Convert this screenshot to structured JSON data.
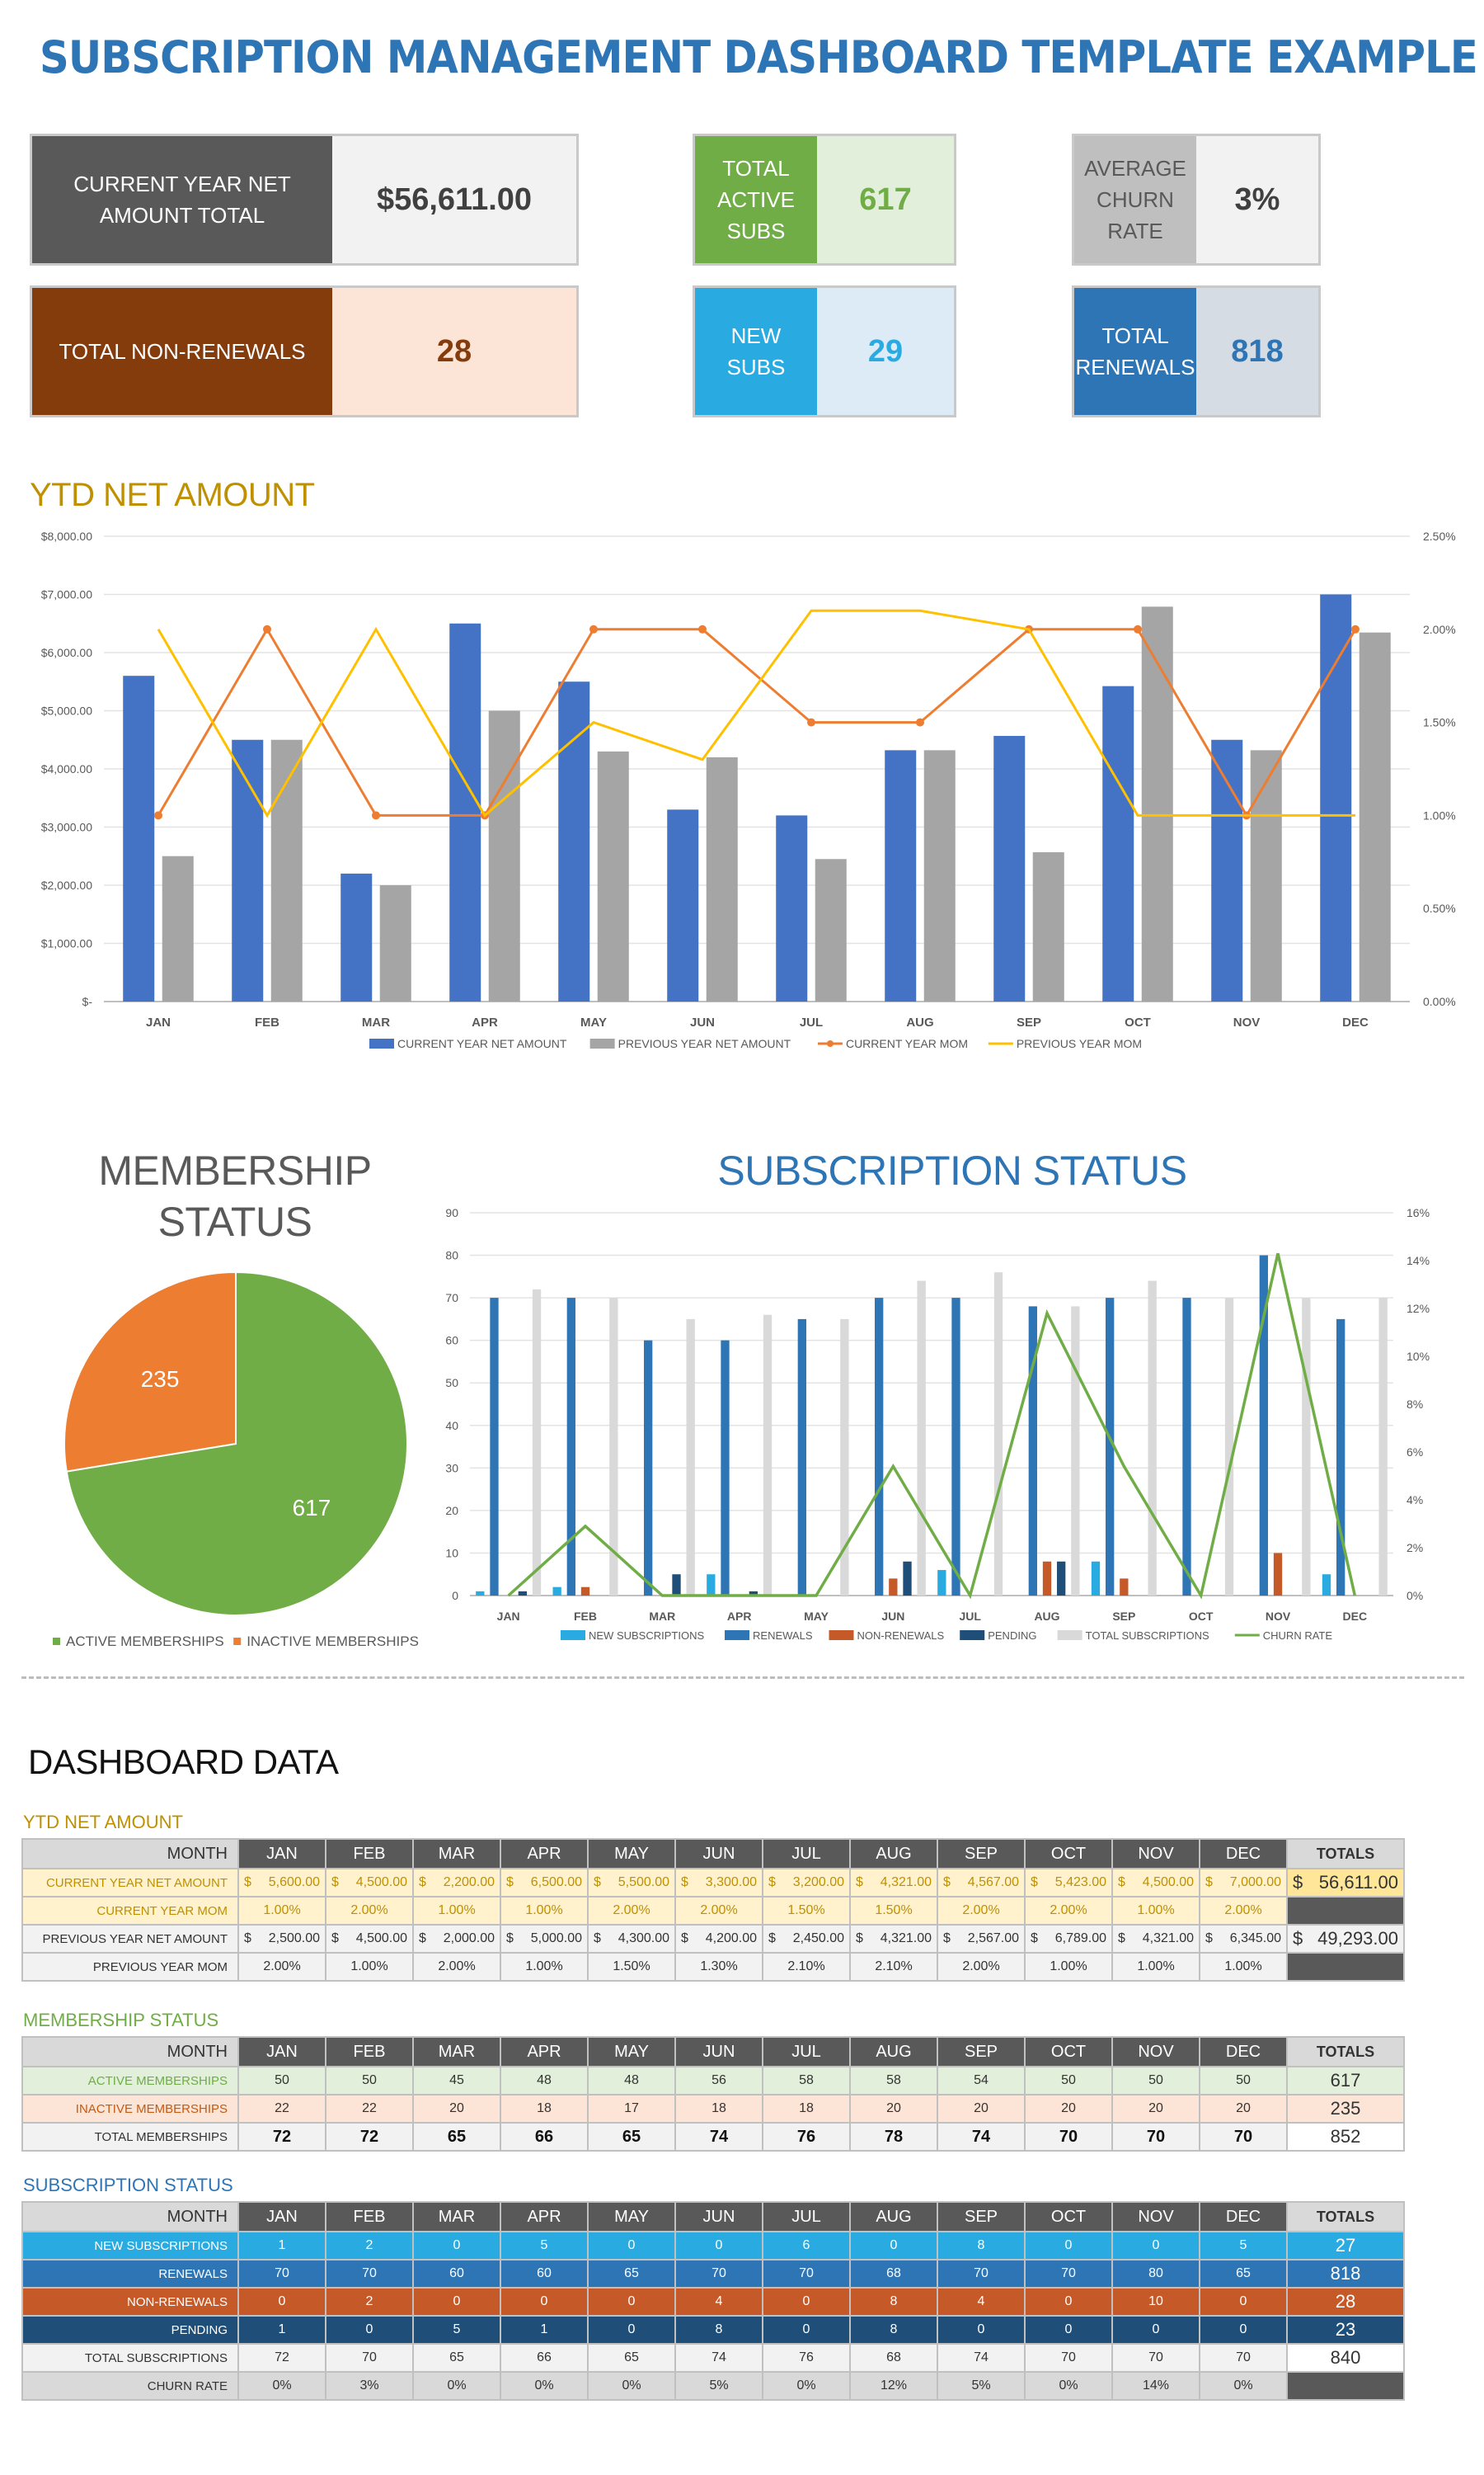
{
  "page": {
    "title": "SUBSCRIPTION MANAGEMENT DASHBOARD TEMPLATE EXAMPLE",
    "colors": {
      "title": "#2e75b6",
      "ytd_heading": "#bf9000",
      "membership_heading": "#595959",
      "subscription_heading": "#2e75b6",
      "table_ytd_caption": "#bf9000",
      "table_membership_caption": "#70ad47",
      "table_subscription_caption": "#2e75b6"
    }
  },
  "kpis": [
    {
      "label": "CURRENT YEAR NET AMOUNT TOTAL",
      "value": "$56,611.00",
      "label_bg": "#595959",
      "value_bg": "#f2f2f2",
      "value_color": "#404040"
    },
    {
      "label": "TOTAL NON-RENEWALS",
      "value": "28",
      "label_bg": "#843c0c",
      "value_bg": "#fce4d6",
      "value_color": "#843c0c"
    },
    {
      "label": "TOTAL ACTIVE SUBS",
      "value": "617",
      "label_bg": "#70ad47",
      "value_bg": "#e2efda",
      "value_color": "#70ad47"
    },
    {
      "label": "NEW SUBS",
      "value": "29",
      "label_bg": "#29abe2",
      "value_bg": "#ddebf7",
      "value_color": "#29abe2"
    },
    {
      "label": "AVERAGE CHURN RATE",
      "value": "3%",
      "label_bg": "#bfbfbf",
      "value_bg": "#f2f2f2",
      "value_color": "#404040",
      "label_color": "#595959"
    },
    {
      "label": "TOTAL RENEWALS",
      "value": "818",
      "label_bg": "#2e75b6",
      "value_bg": "#d6dce4",
      "value_color": "#2e75b6"
    }
  ],
  "chart_data": [
    {
      "id": "ytd",
      "type": "bar",
      "title": "YTD NET AMOUNT",
      "categories": [
        "JAN",
        "FEB",
        "MAR",
        "APR",
        "MAY",
        "JUN",
        "JUL",
        "AUG",
        "SEP",
        "OCT",
        "NOV",
        "DEC"
      ],
      "series": [
        {
          "name": "CURRENT YEAR NET AMOUNT",
          "kind": "bar",
          "axis": "left",
          "color": "#4472c4",
          "values": [
            5600,
            4500,
            2200,
            6500,
            5500,
            3300,
            3200,
            4321,
            4567,
            5423,
            4500,
            7000
          ]
        },
        {
          "name": "PREVIOUS YEAR NET AMOUNT",
          "kind": "bar",
          "axis": "left",
          "color": "#a5a5a5",
          "values": [
            2500,
            4500,
            2000,
            5000,
            4300,
            4200,
            2450,
            4321,
            2567,
            6789,
            4321,
            6345
          ]
        },
        {
          "name": "CURRENT YEAR MOM",
          "kind": "line",
          "axis": "right",
          "color": "#ed7d31",
          "markers": true,
          "values": [
            1.0,
            2.0,
            1.0,
            1.0,
            2.0,
            2.0,
            1.5,
            1.5,
            2.0,
            2.0,
            1.0,
            2.0
          ]
        },
        {
          "name": "PREVIOUS YEAR MOM",
          "kind": "line",
          "axis": "right",
          "color": "#ffc000",
          "markers": false,
          "values": [
            2.0,
            1.0,
            2.0,
            1.0,
            1.5,
            1.3,
            2.1,
            2.1,
            2.0,
            1.0,
            1.0,
            1.0
          ]
        }
      ],
      "ylim": [
        0,
        8000
      ],
      "y_ticks": [
        "$-",
        "$1,000.00",
        "$2,000.00",
        "$3,000.00",
        "$4,000.00",
        "$5,000.00",
        "$6,000.00",
        "$7,000.00",
        "$8,000.00"
      ],
      "y2lim": [
        0,
        2.5
      ],
      "y2_ticks": [
        "0.00%",
        "0.50%",
        "1.00%",
        "1.50%",
        "2.00%",
        "2.50%"
      ],
      "grid": true,
      "legend": "bottom"
    },
    {
      "id": "membership",
      "type": "pie",
      "title": "MEMBERSHIP STATUS",
      "slices": [
        {
          "label": "ACTIVE MEMBERSHIPS",
          "value": 617,
          "color": "#70ad47"
        },
        {
          "label": "INACTIVE MEMBERSHIPS",
          "value": 235,
          "color": "#ed7d31"
        }
      ],
      "legend": "bottom"
    },
    {
      "id": "subscription",
      "type": "bar",
      "title": "SUBSCRIPTION STATUS",
      "categories": [
        "JAN",
        "FEB",
        "MAR",
        "APR",
        "MAY",
        "JUN",
        "JUL",
        "AUG",
        "SEP",
        "OCT",
        "NOV",
        "DEC"
      ],
      "series": [
        {
          "name": "NEW SUBSCRIPTIONS",
          "kind": "bar",
          "axis": "left",
          "color": "#29abe2",
          "values": [
            1,
            2,
            0,
            5,
            0,
            0,
            6,
            0,
            8,
            0,
            0,
            5
          ]
        },
        {
          "name": "RENEWALS",
          "kind": "bar",
          "axis": "left",
          "color": "#2e75b6",
          "values": [
            70,
            70,
            60,
            60,
            65,
            70,
            70,
            68,
            70,
            70,
            80,
            65
          ]
        },
        {
          "name": "NON-RENEWALS",
          "kind": "bar",
          "axis": "left",
          "color": "#c55a28",
          "values": [
            0,
            2,
            0,
            0,
            0,
            4,
            0,
            8,
            4,
            0,
            10,
            0
          ]
        },
        {
          "name": "PENDING",
          "kind": "bar",
          "axis": "left",
          "color": "#1f4e79",
          "values": [
            1,
            0,
            5,
            1,
            0,
            8,
            0,
            8,
            0,
            0,
            0,
            0
          ]
        },
        {
          "name": "TOTAL SUBSCRIPTIONS",
          "kind": "bar",
          "axis": "left",
          "color": "#d9d9d9",
          "values": [
            72,
            70,
            65,
            66,
            65,
            74,
            76,
            68,
            74,
            70,
            70,
            70
          ]
        },
        {
          "name": "CHURN RATE",
          "kind": "line",
          "axis": "right",
          "color": "#70ad47",
          "values": [
            0,
            2.9,
            0,
            0,
            0,
            5.4,
            0,
            11.8,
            5.4,
            0,
            14.3,
            0
          ]
        }
      ],
      "ylim": [
        0,
        90
      ],
      "y_ticks": [
        "0",
        "10",
        "20",
        "30",
        "40",
        "50",
        "60",
        "70",
        "80",
        "90"
      ],
      "y2lim": [
        0,
        16
      ],
      "y2_ticks": [
        "0%",
        "2%",
        "4%",
        "6%",
        "8%",
        "10%",
        "12%",
        "14%",
        "16%"
      ],
      "grid": true,
      "legend": "bottom"
    }
  ],
  "dashboard_data": {
    "heading": "DASHBOARD DATA",
    "months": [
      "JAN",
      "FEB",
      "MAR",
      "APR",
      "MAY",
      "JUN",
      "JUL",
      "AUG",
      "SEP",
      "OCT",
      "NOV",
      "DEC"
    ],
    "month_header": "MONTH",
    "totals_header": "TOTALS",
    "ytd": {
      "caption": "YTD NET AMOUNT",
      "rows": [
        {
          "label": "CURRENT YEAR NET AMOUNT",
          "money": true,
          "values": [
            "5,600.00",
            "4,500.00",
            "2,200.00",
            "6,500.00",
            "5,500.00",
            "3,300.00",
            "3,200.00",
            "4,321.00",
            "4,567.00",
            "5,423.00",
            "4,500.00",
            "7,000.00"
          ],
          "total": "56,611.00",
          "bg": "#fff2cc",
          "color": "#bf9000",
          "total_bg": "#ffe699",
          "total_color": "#333333"
        },
        {
          "label": "CURRENT YEAR MOM",
          "money": false,
          "values": [
            "1.00%",
            "2.00%",
            "1.00%",
            "1.00%",
            "2.00%",
            "2.00%",
            "1.50%",
            "1.50%",
            "2.00%",
            "2.00%",
            "1.00%",
            "2.00%"
          ],
          "total": "",
          "bg": "#fff2cc",
          "color": "#bf9000",
          "total_bg": "#595959",
          "total_color": "#ffffff"
        },
        {
          "label": "PREVIOUS YEAR NET AMOUNT",
          "money": true,
          "values": [
            "2,500.00",
            "4,500.00",
            "2,000.00",
            "5,000.00",
            "4,300.00",
            "4,200.00",
            "2,450.00",
            "4,321.00",
            "2,567.00",
            "6,789.00",
            "4,321.00",
            "6,345.00"
          ],
          "total": "49,293.00",
          "bg": "#f2f2f2",
          "color": "#333333",
          "total_bg": "#f2f2f2",
          "total_color": "#333333"
        },
        {
          "label": "PREVIOUS YEAR MOM",
          "money": false,
          "values": [
            "2.00%",
            "1.00%",
            "2.00%",
            "1.00%",
            "1.50%",
            "1.30%",
            "2.10%",
            "2.10%",
            "2.00%",
            "1.00%",
            "1.00%",
            "1.00%"
          ],
          "total": "",
          "bg": "#f2f2f2",
          "color": "#333333",
          "total_bg": "#595959",
          "total_color": "#ffffff"
        }
      ]
    },
    "membership": {
      "caption": "MEMBERSHIP STATUS",
      "rows": [
        {
          "label": "ACTIVE MEMBERSHIPS",
          "values": [
            "50",
            "50",
            "45",
            "48",
            "48",
            "56",
            "58",
            "58",
            "54",
            "50",
            "50",
            "50"
          ],
          "total": "617",
          "bg": "#e2efda",
          "color": "#70ad47",
          "cell_color": "#333333",
          "total_bg": "#e2efda",
          "total_color": "#333333"
        },
        {
          "label": "INACTIVE MEMBERSHIPS",
          "values": [
            "22",
            "22",
            "20",
            "18",
            "17",
            "18",
            "18",
            "20",
            "20",
            "20",
            "20",
            "20"
          ],
          "total": "235",
          "bg": "#fce4d6",
          "color": "#c55a11",
          "cell_color": "#333333",
          "total_bg": "#fce4d6",
          "total_color": "#333333"
        },
        {
          "label": "TOTAL MEMBERSHIPS",
          "values": [
            "72",
            "72",
            "65",
            "66",
            "65",
            "74",
            "76",
            "78",
            "74",
            "70",
            "70",
            "70"
          ],
          "total": "852",
          "bg": "#f2f2f2",
          "color": "#333333",
          "cell_color": "#111111",
          "bold": true,
          "total_bg": "#ffffff",
          "total_color": "#333333"
        }
      ]
    },
    "subscription": {
      "caption": "SUBSCRIPTION STATUS",
      "rows": [
        {
          "label": "NEW SUBSCRIPTIONS",
          "values": [
            "1",
            "2",
            "0",
            "5",
            "0",
            "0",
            "6",
            "0",
            "8",
            "0",
            "0",
            "5"
          ],
          "total": "27",
          "bg": "#29abe2",
          "color": "#ffffff",
          "cell_color": "#ffffff",
          "total_bg": "#29abe2",
          "total_color": "#ffffff"
        },
        {
          "label": "RENEWALS",
          "values": [
            "70",
            "70",
            "60",
            "60",
            "65",
            "70",
            "70",
            "68",
            "70",
            "70",
            "80",
            "65"
          ],
          "total": "818",
          "bg": "#2e75b6",
          "color": "#ffffff",
          "cell_color": "#ffffff",
          "total_bg": "#2e75b6",
          "total_color": "#ffffff"
        },
        {
          "label": "NON-RENEWALS",
          "values": [
            "0",
            "2",
            "0",
            "0",
            "0",
            "4",
            "0",
            "8",
            "4",
            "0",
            "10",
            "0"
          ],
          "total": "28",
          "bg": "#c55a28",
          "color": "#ffffff",
          "cell_color": "#ffffff",
          "total_bg": "#c55a28",
          "total_color": "#ffffff"
        },
        {
          "label": "PENDING",
          "values": [
            "1",
            "0",
            "5",
            "1",
            "0",
            "8",
            "0",
            "8",
            "0",
            "0",
            "0",
            "0"
          ],
          "total": "23",
          "bg": "#1f4e79",
          "color": "#ffffff",
          "cell_color": "#ffffff",
          "total_bg": "#1f4e79",
          "total_color": "#ffffff"
        },
        {
          "label": "TOTAL SUBSCRIPTIONS",
          "values": [
            "72",
            "70",
            "65",
            "66",
            "65",
            "74",
            "76",
            "68",
            "74",
            "70",
            "70",
            "70"
          ],
          "total": "840",
          "bg": "#f2f2f2",
          "color": "#333333",
          "cell_color": "#333333",
          "total_bg": "#ffffff",
          "total_color": "#333333"
        },
        {
          "label": "CHURN RATE",
          "values": [
            "0%",
            "3%",
            "0%",
            "0%",
            "0%",
            "5%",
            "0%",
            "12%",
            "5%",
            "0%",
            "14%",
            "0%"
          ],
          "total": "",
          "bg": "#d9d9d9",
          "color": "#333333",
          "cell_color": "#333333",
          "total_bg": "#595959",
          "total_color": "#ffffff"
        }
      ]
    }
  }
}
